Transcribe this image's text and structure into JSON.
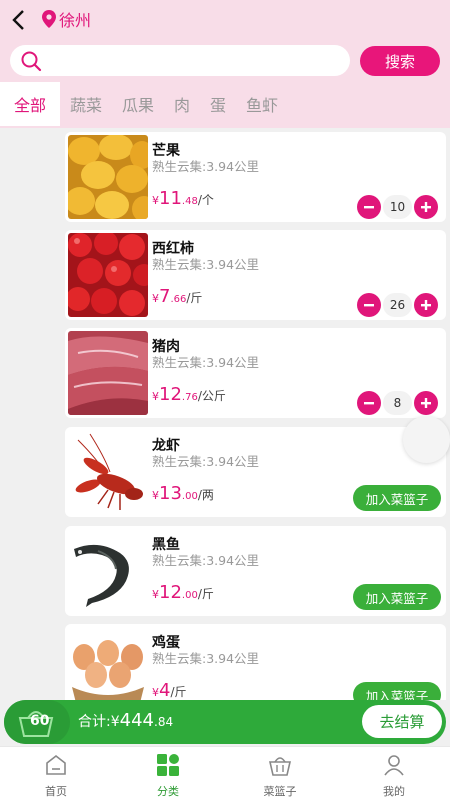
{
  "header": {
    "location": "徐州",
    "search_placeholder": "",
    "search_button": "搜索"
  },
  "tabs": [
    {
      "label": "全部",
      "active": true
    },
    {
      "label": "蔬菜",
      "active": false
    },
    {
      "label": "瓜果",
      "active": false
    },
    {
      "label": "肉",
      "active": false
    },
    {
      "label": "蛋",
      "active": false
    },
    {
      "label": "鱼虾",
      "active": false
    }
  ],
  "products": [
    {
      "name": "芒果",
      "store": "熟生云集:3.94公里",
      "currency": "¥",
      "price_int": "11",
      "price_dec": ".48",
      "unit": "/个",
      "qty": "10",
      "in_cart": true,
      "image": "mango"
    },
    {
      "name": "西红柿",
      "store": "熟生云集:3.94公里",
      "currency": "¥",
      "price_int": "7",
      "price_dec": ".66",
      "unit": "/斤",
      "qty": "26",
      "in_cart": true,
      "image": "tomato"
    },
    {
      "name": "猪肉",
      "store": "熟生云集:3.94公里",
      "currency": "¥",
      "price_int": "12",
      "price_dec": ".76",
      "unit": "/公斤",
      "qty": "8",
      "in_cart": true,
      "image": "pork"
    },
    {
      "name": "龙虾",
      "store": "熟生云集:3.94公里",
      "currency": "¥",
      "price_int": "13",
      "price_dec": ".00",
      "unit": "/两",
      "qty": "",
      "in_cart": false,
      "add_label": "加入菜篮子",
      "image": "crayfish"
    },
    {
      "name": "黑鱼",
      "store": "熟生云集:3.94公里",
      "currency": "¥",
      "price_int": "12",
      "price_dec": ".00",
      "unit": "/斤",
      "qty": "",
      "in_cart": false,
      "add_label": "加入菜篮子",
      "image": "fish"
    },
    {
      "name": "鸡蛋",
      "store": "熟生云集:3.94公里",
      "currency": "¥",
      "price_int": "4",
      "price_dec": "",
      "unit": "/斤",
      "qty": "",
      "in_cart": false,
      "add_label": "加入菜篮子",
      "image": "eggs"
    }
  ],
  "cart": {
    "count": "60",
    "total_label": "合计:",
    "currency": "¥",
    "total_int": "444",
    "total_dec": ".84",
    "checkout_label": "去结算"
  },
  "bottom_nav": [
    {
      "label": "首页",
      "icon": "home-icon",
      "active": false
    },
    {
      "label": "分类",
      "icon": "category-icon",
      "active": true
    },
    {
      "label": "菜篮子",
      "icon": "basket-icon",
      "active": false
    },
    {
      "label": "我的",
      "icon": "user-icon",
      "active": false
    }
  ],
  "colors": {
    "accent": "#e0167a",
    "header_bg": "#f8dde8",
    "green": "#2eaa3a"
  }
}
